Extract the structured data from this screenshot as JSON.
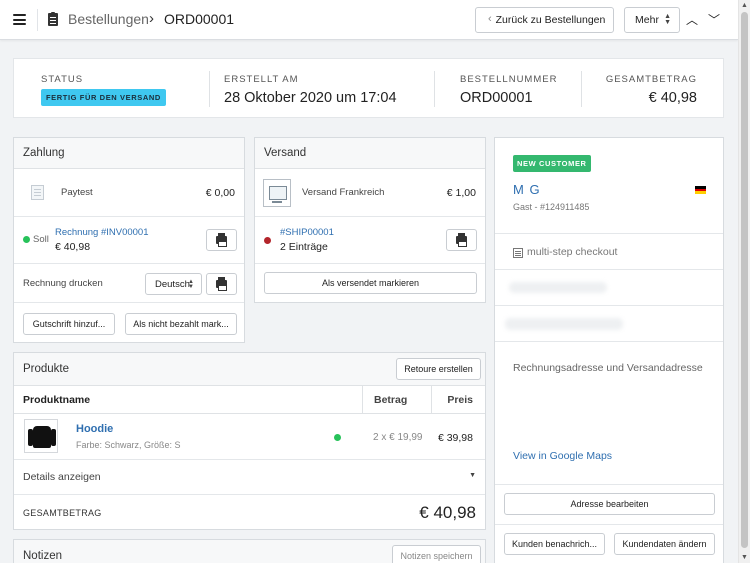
{
  "header": {
    "breadcrumb_root": "Bestellungen",
    "breadcrumb_current": "ORD00001",
    "back_button": "Zurück zu Bestellungen",
    "more_button": "Mehr"
  },
  "summary": {
    "status_label": "STATUS",
    "status_value": "FERTIG FÜR DEN VERSAND",
    "created_label": "ERSTELLT AM",
    "created_value": "28 Oktober 2020 um 17:04",
    "number_label": "BESTELLNUMMER",
    "number_value": "ORD00001",
    "total_label": "GESAMTBETRAG",
    "total_value": "€ 40,98"
  },
  "payment": {
    "title": "Zahlung",
    "method": "Paytest",
    "method_amount": "€ 0,00",
    "status": "Soll",
    "invoice_link": "Rechnung #INV00001",
    "invoice_amount": "€ 40,98",
    "print_invoice_label": "Rechnung drucken",
    "language": "Deutsch",
    "credit_button": "Gutschrift hinzuf...",
    "unpaid_button": "Als nicht bezahlt mark..."
  },
  "shipping": {
    "title": "Versand",
    "method": "Versand Frankreich",
    "method_amount": "€ 1,00",
    "shipment_link": "#SHIP00001",
    "entries": "2 Einträge",
    "mark_shipped_button": "Als versendet markieren"
  },
  "customer": {
    "badge": "NEW CUSTOMER",
    "name": "M G",
    "guest_id": "Gast - #124911485",
    "checkout": "multi-step checkout",
    "address_title": "Rechnungsadresse und Versandadresse",
    "maps_link": "View in Google Maps",
    "edit_address_button": "Adresse bearbeiten",
    "notify_button": "Kunden benachrich...",
    "edit_customer_button": "Kundendaten ändern"
  },
  "products": {
    "title": "Produkte",
    "return_button": "Retoure erstellen",
    "columns": [
      "Produktname",
      "Betrag",
      "Preis"
    ],
    "items": [
      {
        "name": "Hoodie",
        "variant": "Farbe: Schwarz, Größe: S",
        "quantity": "2 x € 19,99",
        "price": "€ 39,98"
      }
    ],
    "details_toggle": "Details anzeigen",
    "total_label": "GESAMTBETRAG",
    "total_value": "€ 40,98"
  },
  "notes": {
    "title": "Notizen",
    "save_button": "Notizen speichern"
  },
  "colors": {
    "status_badge": "#3fc8f0",
    "new_customer_badge": "#34b86f",
    "link": "#2f6fb0",
    "paid_dot": "#27c25a",
    "ship_dot": "#b3252b",
    "stock_dot": "#27c25a"
  },
  "icons": {
    "menu": "hamburger-icon",
    "orders": "document-icon",
    "printer": "printer-icon",
    "flag": "german-flag-icon",
    "checkout": "list-icon"
  }
}
